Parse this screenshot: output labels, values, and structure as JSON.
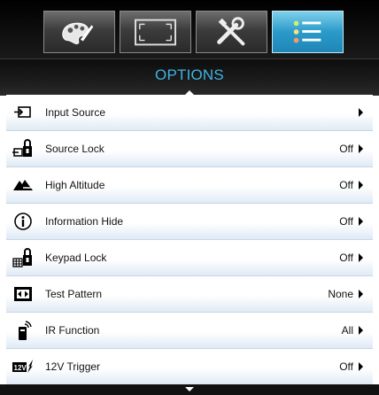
{
  "tabs": [
    {
      "icon": "palette-icon",
      "active": false
    },
    {
      "icon": "display-frame-icon",
      "active": false
    },
    {
      "icon": "tools-icon",
      "active": false
    },
    {
      "icon": "options-list-icon",
      "active": true
    }
  ],
  "header": {
    "title": "OPTIONS"
  },
  "menu": {
    "items": [
      {
        "label": "Input Source",
        "value": "",
        "icon": "input-source-icon"
      },
      {
        "label": "Source Lock",
        "value": "Off",
        "icon": "source-lock-icon"
      },
      {
        "label": "High Altitude",
        "value": "Off",
        "icon": "high-altitude-icon"
      },
      {
        "label": "Information Hide",
        "value": "Off",
        "icon": "information-icon"
      },
      {
        "label": "Keypad Lock",
        "value": "Off",
        "icon": "keypad-lock-icon"
      },
      {
        "label": "Test Pattern",
        "value": "None",
        "icon": "test-pattern-icon"
      },
      {
        "label": "IR Function",
        "value": "All",
        "icon": "ir-remote-icon"
      },
      {
        "label": "12V Trigger",
        "value": "Off",
        "icon": "trigger-12v-icon"
      }
    ]
  },
  "colors": {
    "accent": "#3fb3e2",
    "active_tab": "#2a9ac9"
  }
}
